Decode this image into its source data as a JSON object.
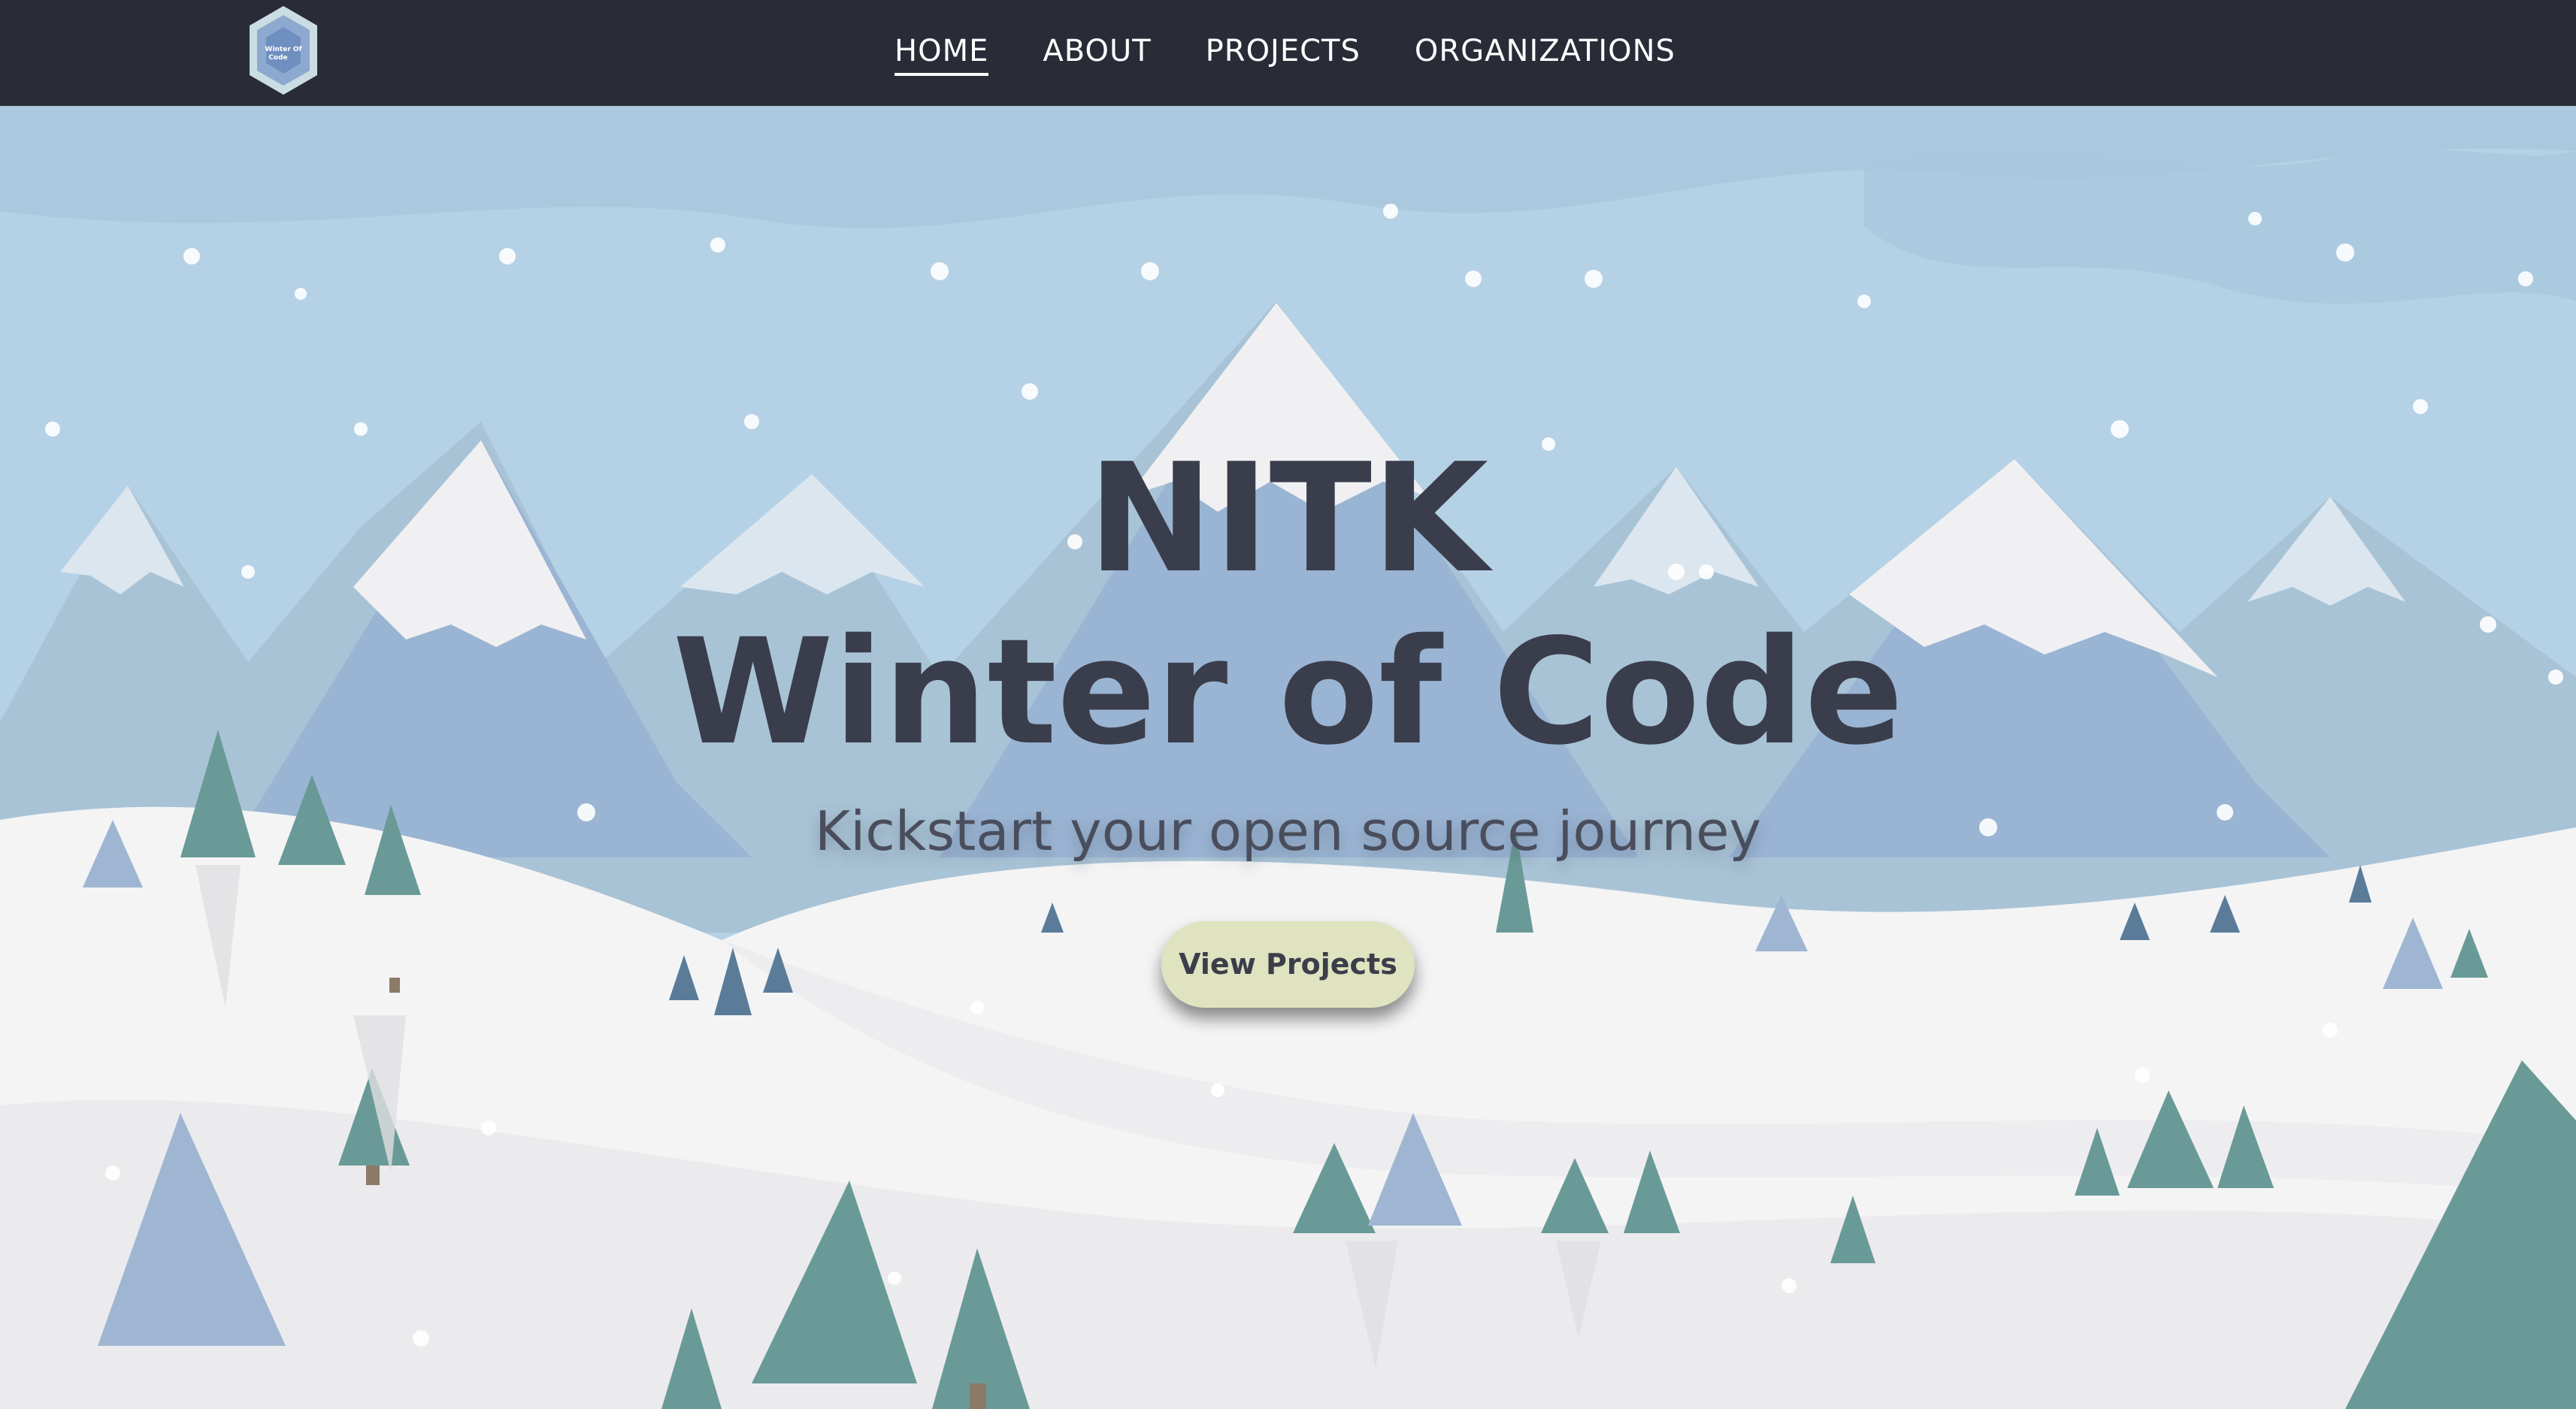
{
  "nav": {
    "logo_text_line1": "Winter Of",
    "logo_text_line2": "Code",
    "items": [
      {
        "label": "HOME",
        "active": true
      },
      {
        "label": "ABOUT",
        "active": false
      },
      {
        "label": "PROJECTS",
        "active": false
      },
      {
        "label": "ORGANIZATIONS",
        "active": false
      }
    ]
  },
  "hero": {
    "title_line1": "NITK",
    "title_line2": "Winter of Code",
    "subtitle": "Kickstart your open source journey",
    "cta_label": "View Projects"
  },
  "colors": {
    "navbar": "#292c37",
    "sky": "#b5d1e5",
    "title_text": "#3a3d4b",
    "cta_bg": "#dfe3bf"
  }
}
